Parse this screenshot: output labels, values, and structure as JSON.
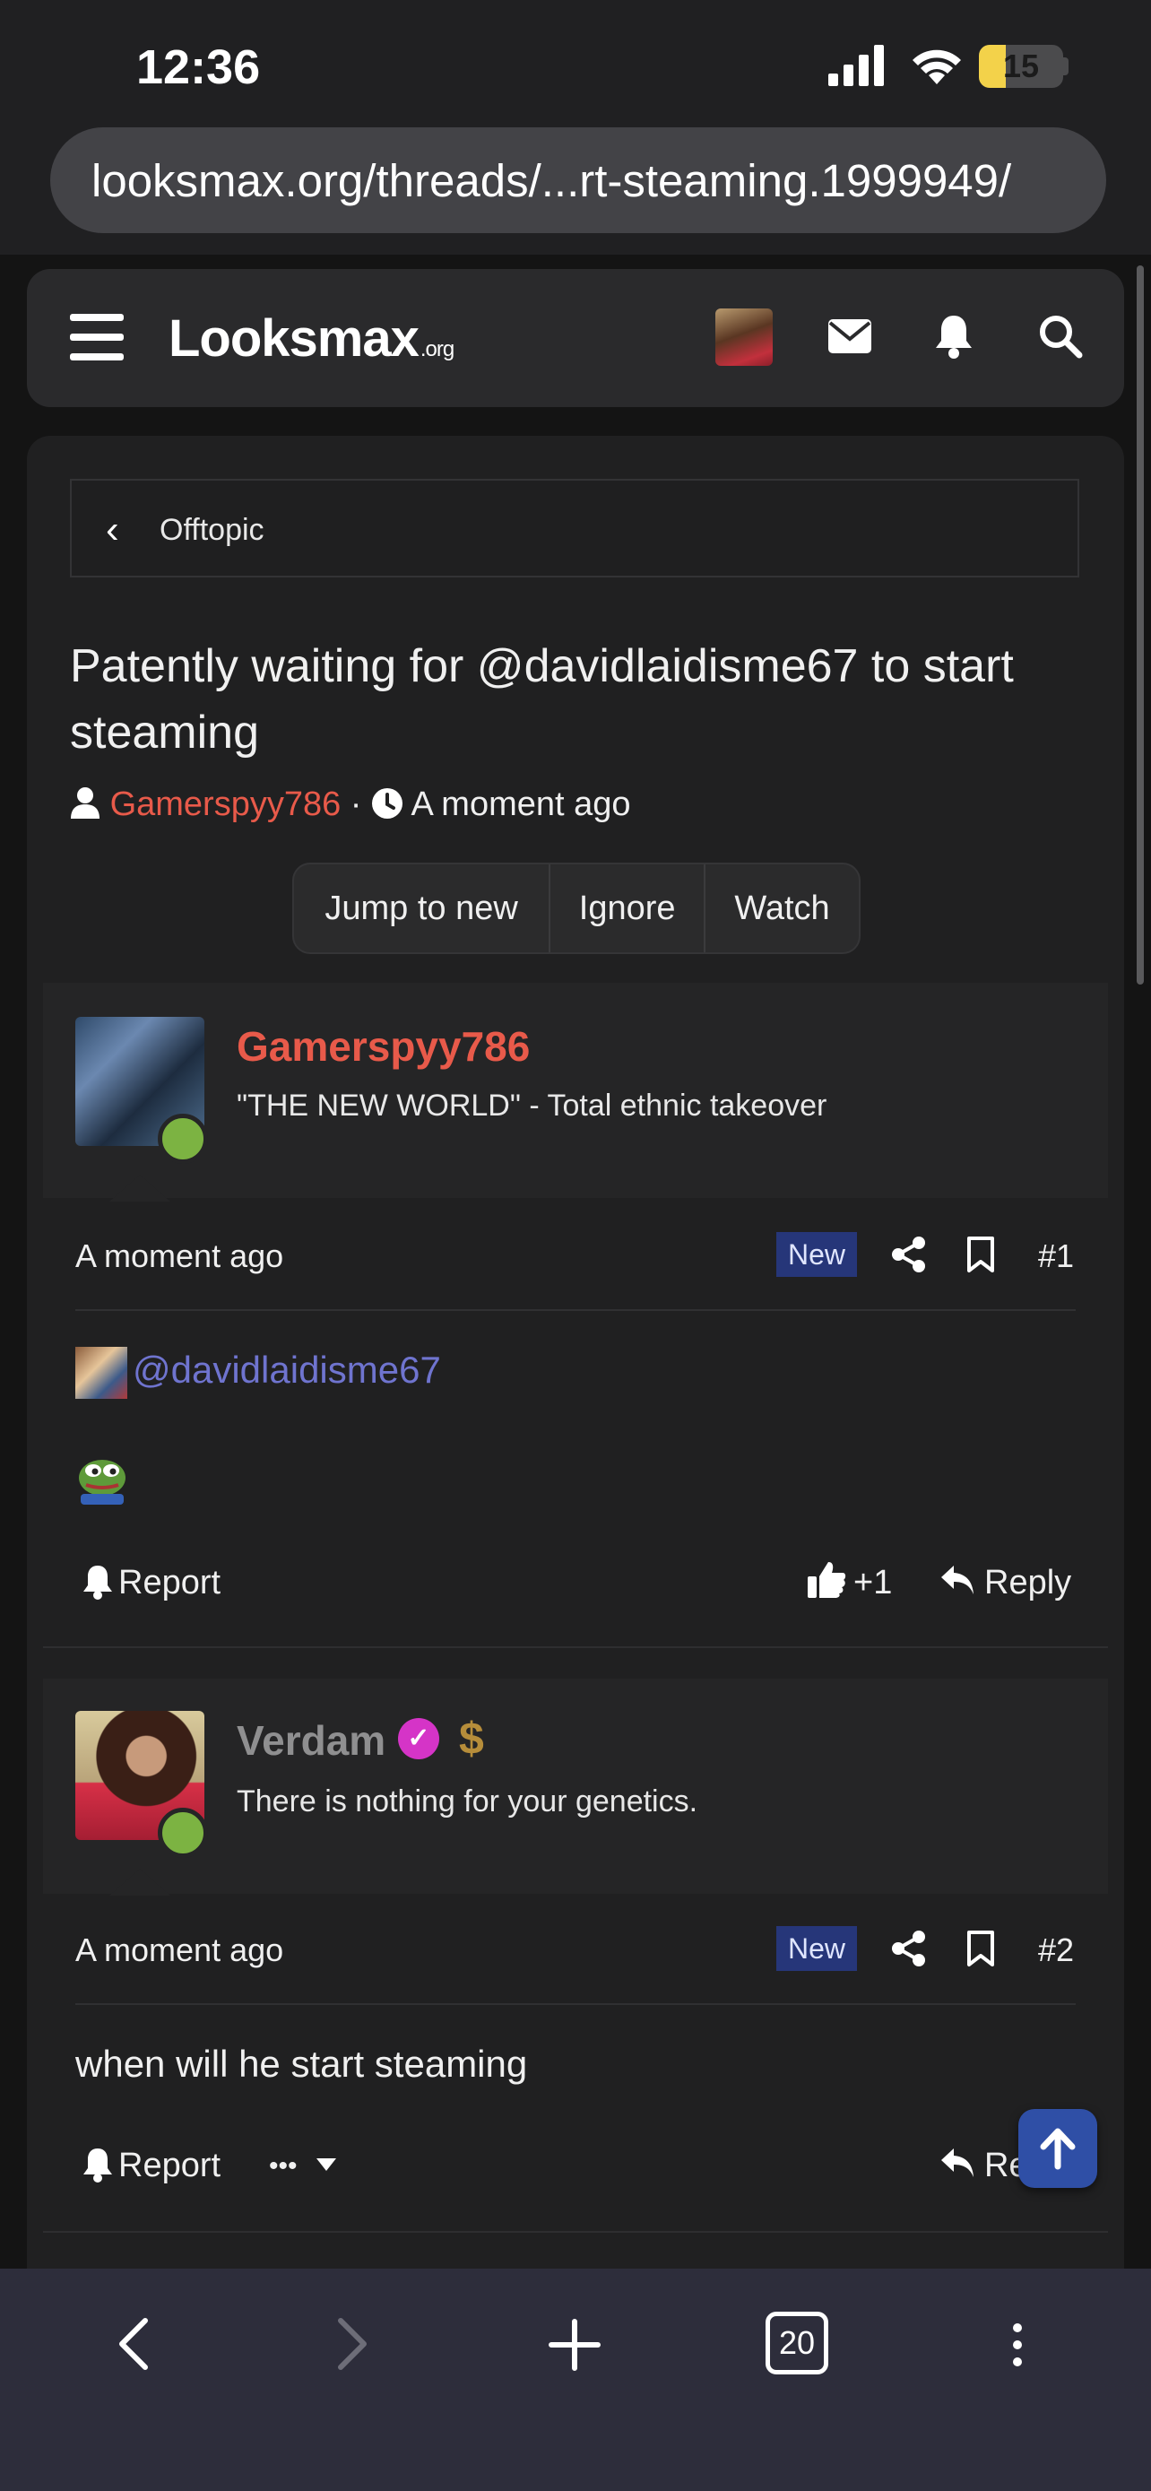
{
  "status": {
    "time": "12:36",
    "battery": "15"
  },
  "browser": {
    "url": "looksmax.org/threads/...rt-steaming.1999949/",
    "tab_count": "20"
  },
  "site": {
    "logo_main": "Looksmax",
    "logo_suffix": ".org"
  },
  "breadcrumb": {
    "label": "Offtopic"
  },
  "thread": {
    "title": "Patently waiting for @davidlaidisme67 to start steaming",
    "author": "Gamerspyy786",
    "separator": "·",
    "time": "A moment ago",
    "buttons": [
      "Jump to new",
      "Ignore",
      "Watch"
    ]
  },
  "posts": [
    {
      "username": "Gamerspyy786",
      "user_title": "\"THE NEW WORLD\" - Total ethnic takeover",
      "time": "A moment ago",
      "badge": "New",
      "number": "#1",
      "mention": "@davidlaidisme67",
      "report": "Report",
      "like_count": "+1",
      "reply": "Reply"
    },
    {
      "username": "Verdam",
      "user_title": "There is nothing for your genetics.",
      "time": "A moment ago",
      "badge": "New",
      "number": "#2",
      "body": "when will he start steaming",
      "report": "Report",
      "more": "•••",
      "reply": "Reply"
    }
  ],
  "colors": {
    "accent_red": "#e85a4a",
    "mention": "#6f74cf",
    "badge_bg": "#263679",
    "online": "#7cb342"
  }
}
